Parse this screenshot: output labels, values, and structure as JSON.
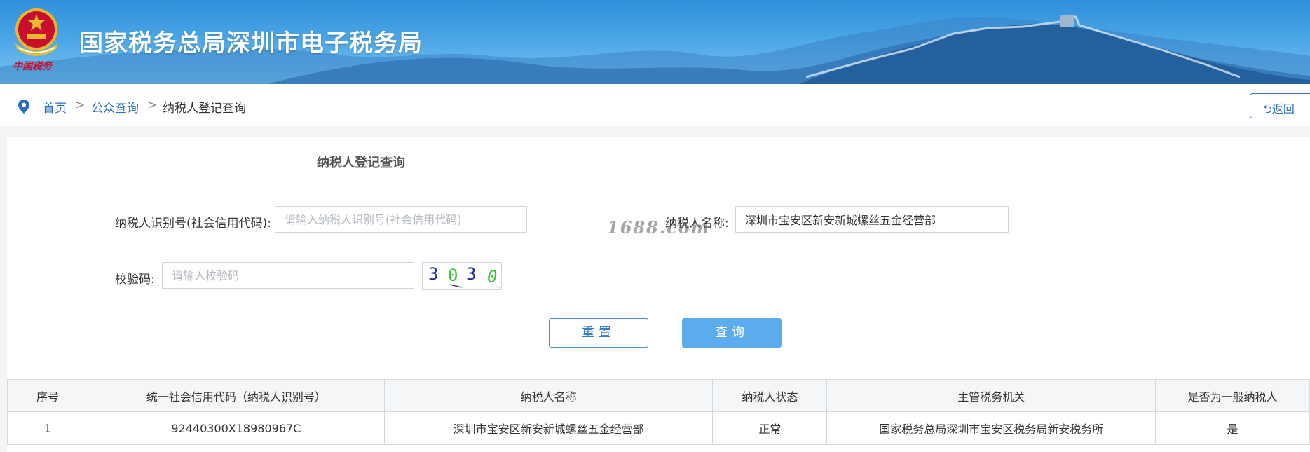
{
  "header": {
    "site_title": "国家税务总局深圳市电子税务局",
    "emblem_text": "中国税务"
  },
  "breadcrumb": {
    "home": "首页",
    "separator": ">",
    "public_query": "公众查询",
    "current": "纳税人登记查询",
    "back_label": "⮌返回"
  },
  "form": {
    "title": "纳税人登记查询",
    "taxpayer_id_label": "纳税人识别号(社会信用代码):",
    "taxpayer_id_placeholder": "请输入纳税人识别号(社会信用代码)",
    "taxpayer_id_value": "",
    "taxpayer_name_label": "纳税人名称:",
    "taxpayer_name_value": "深圳市宝安区新安新城螺丝五金经营部",
    "captcha_label": "校验码:",
    "captcha_placeholder": "请输入校验码",
    "captcha_chars": [
      "3",
      "0",
      "3",
      "0"
    ],
    "reset_label": "重置",
    "query_label": "查询"
  },
  "watermark": "1688.com",
  "results": {
    "columns": [
      "序号",
      "统一社会信用代码（纳税人识别号）",
      "纳税人名称",
      "纳税人状态",
      "主管税务机关",
      "是否为一般纳税人"
    ],
    "rows": [
      [
        "1",
        "92440300X18980967C",
        "深圳市宝安区新安新城螺丝五金经营部",
        "正常",
        "国家税务总局深圳市宝安区税务局新安税务所",
        "是"
      ]
    ]
  },
  "colors": {
    "banner_blue": "#2e8fd9",
    "link_blue": "#2a6fb7",
    "query_button": "#5aacee",
    "emblem_red": "#c8102e",
    "emblem_gold": "#e8b92e"
  },
  "icons": {
    "location": "location-pin-icon",
    "emblem": "national-emblem-icon"
  }
}
